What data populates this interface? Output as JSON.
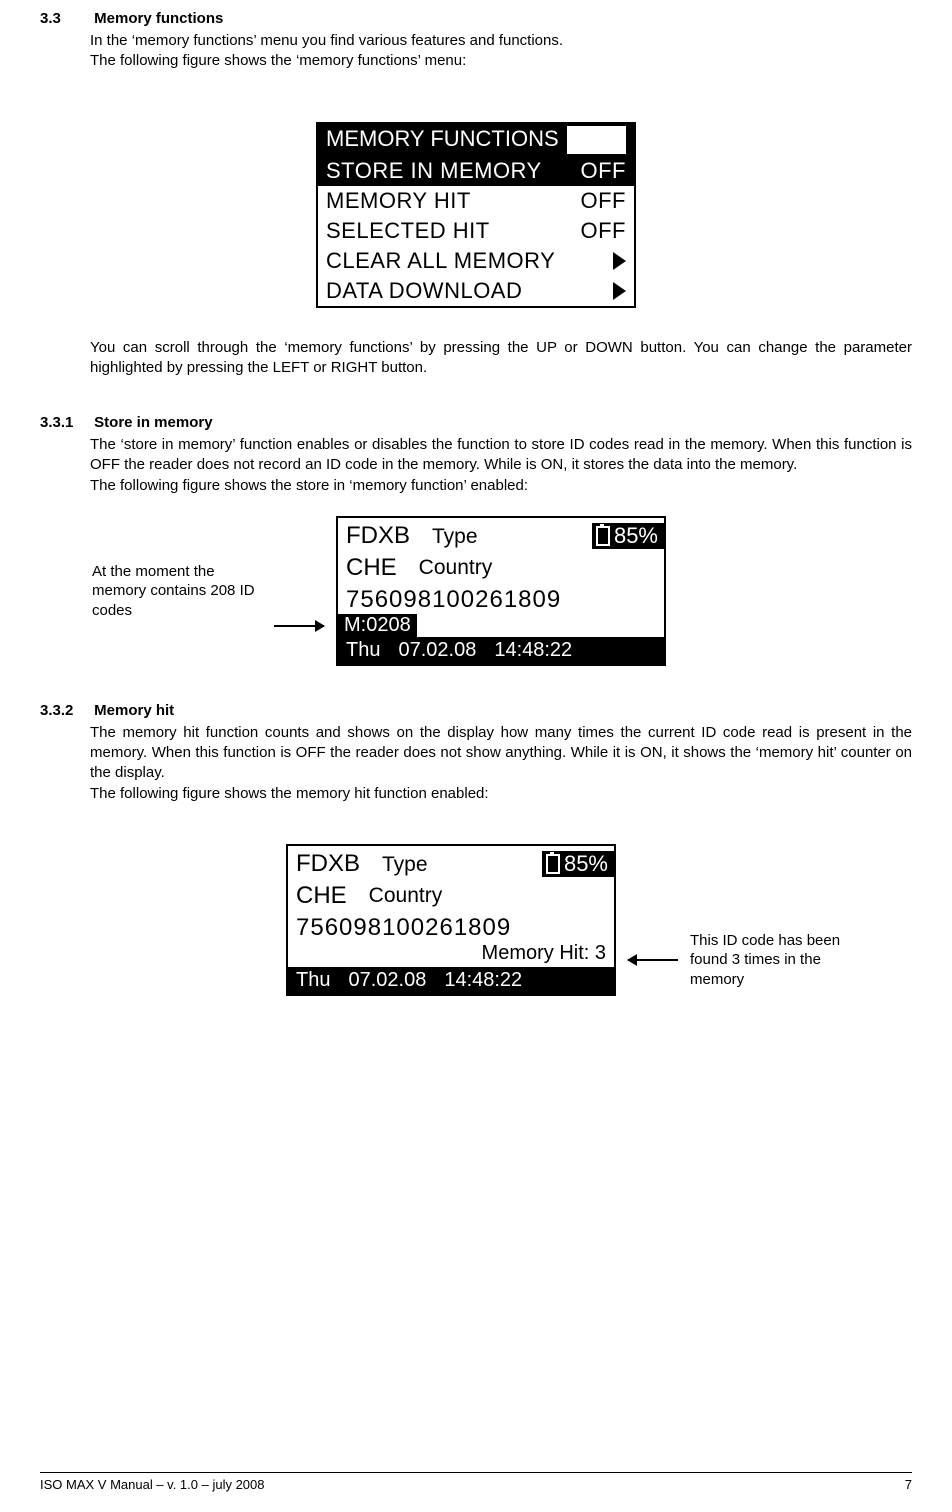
{
  "section": {
    "num": "3.3",
    "title": "Memory functions",
    "intro1": "In the ‘memory functions’ menu you find various features and functions.",
    "intro2": "The following figure shows the ‘memory functions’ menu:",
    "after_menu": "You can scroll through the ‘memory functions’ by pressing the UP or DOWN button. You can change the parameter highlighted by pressing the LEFT or RIGHT button."
  },
  "menu": {
    "title": "MEMORY FUNCTIONS",
    "rows": [
      {
        "label": "STORE IN MEMORY",
        "value": "OFF",
        "inverted": true
      },
      {
        "label": "MEMORY HIT",
        "value": "OFF"
      },
      {
        "label": "SELECTED HIT",
        "value": "OFF"
      },
      {
        "label": "CLEAR ALL MEMORY",
        "arrow": true
      },
      {
        "label": "DATA DOWNLOAD",
        "arrow": true
      }
    ]
  },
  "sub1": {
    "num": "3.3.1",
    "title": "Store in memory",
    "p1": "The ‘store in memory’ function enables or disables the function to store ID codes read in the memory. When this function is OFF the reader does not record an ID code in the memory. While is ON, it stores the data into the memory.",
    "p2": "The following figure shows the store in ‘memory function’ enabled:"
  },
  "screen1": {
    "battery": "85%",
    "type_code": "FDXB",
    "type_label": "Type",
    "country_code": "CHE",
    "country_label": "Country",
    "id": "756098100261809",
    "mcount": "M:0208",
    "timestamp_day": "Thu",
    "timestamp_date": "07.02.08",
    "timestamp_time": "14:48:22"
  },
  "callout1": "At the moment the memory contains 208 ID codes",
  "sub2": {
    "num": "3.3.2",
    "title": "Memory hit",
    "p1": "The memory hit function counts and shows on the display how many times the current ID code read is present in the memory. When this function is OFF the reader does not show anything. While it is ON, it shows the ‘memory hit’ counter on the display.",
    "p2": "The following figure shows the memory hit function enabled:"
  },
  "screen2": {
    "battery": "85%",
    "type_code": "FDXB",
    "type_label": "Type",
    "country_code": "CHE",
    "country_label": "Country",
    "id": "756098100261809",
    "memhit": "Memory Hit: 3",
    "timestamp_day": "Thu",
    "timestamp_date": "07.02.08",
    "timestamp_time": "14:48:22"
  },
  "callout2": "This ID code has been found 3 times in the memory",
  "footer": {
    "left": "ISO MAX V Manual – v. 1.0 – july 2008",
    "right": "7"
  }
}
